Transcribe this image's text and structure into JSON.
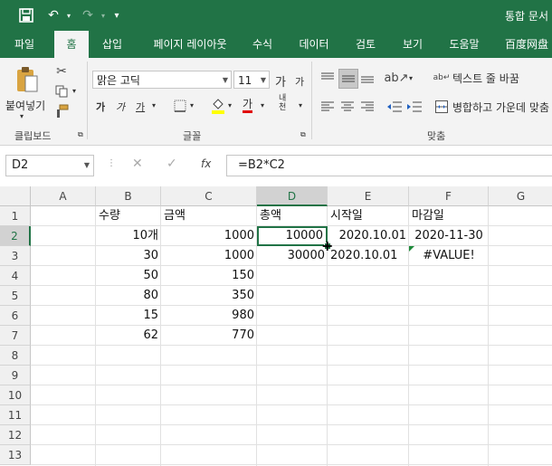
{
  "title_bar": {
    "doc_title": "통합 문서"
  },
  "tabs": [
    "파일",
    "홈",
    "삽입",
    "페이지 레이아웃",
    "수식",
    "데이터",
    "검토",
    "보기",
    "도움말",
    "百度网盘"
  ],
  "ribbon": {
    "clipboard": {
      "paste": "붙여넣기",
      "label": "클립보드"
    },
    "font": {
      "name": "맑은 고딕",
      "size": "11",
      "label": "글꼴",
      "grow": "가",
      "shrink": "가",
      "bold": "가",
      "italic": "가",
      "underline": "가",
      "font_color_glyph": "가",
      "phonetic": "내천"
    },
    "alignment": {
      "wrap_text": "텍스트 줄 바꿈",
      "merge_center": "병합하고 가운데 맞춤",
      "label": "맞춤"
    },
    "colors": {
      "accent": "#217346",
      "fill_yellow": "#ffff00",
      "font_red": "#e00000"
    }
  },
  "formula_bar": {
    "name_box": "D2",
    "fx": "fx",
    "formula": "=B2*C2"
  },
  "sheet": {
    "columns": [
      "A",
      "B",
      "C",
      "D",
      "E",
      "F",
      "G"
    ],
    "rows": [
      "1",
      "2",
      "3",
      "4",
      "5",
      "6",
      "7",
      "8",
      "9",
      "10",
      "11",
      "12",
      "13"
    ],
    "selected_cell": "D2",
    "cells": {
      "B1": "수량",
      "C1": "금액",
      "D1": "총액",
      "E1": "시작일",
      "F1": "마감일",
      "B2": "10개",
      "C2": "1000",
      "D2": "10000",
      "E2": "2020.10.01",
      "F2": "2020-11-30",
      "B3": "30",
      "C3": "1000",
      "D3": "30000",
      "E3": "2020.10.01",
      "F3": "#VALUE!",
      "B4": "50",
      "C4": "150",
      "B5": "80",
      "C5": "350",
      "B6": "15",
      "C6": "980",
      "B7": "62",
      "C7": "770"
    }
  }
}
